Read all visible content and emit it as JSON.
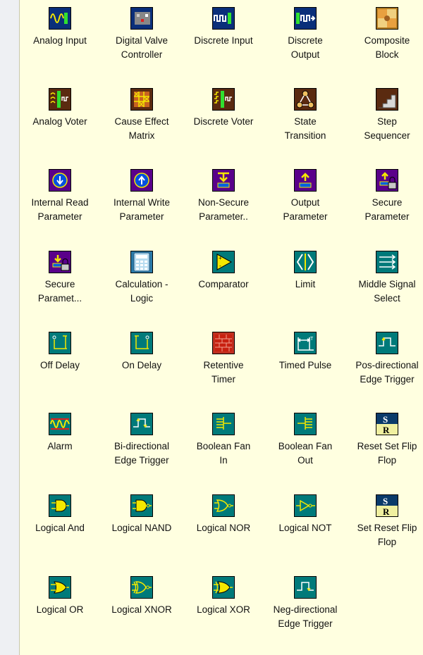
{
  "palette": {
    "items": [
      {
        "label_lines": [
          "Analog Input"
        ],
        "icon": "analog-input-icon",
        "color": "#0a2f7a"
      },
      {
        "label_lines": [
          "Digital Valve",
          "Controller"
        ],
        "icon": "digital-valve-controller-icon",
        "color": "#0a2f7a"
      },
      {
        "label_lines": [
          "Discrete Input"
        ],
        "icon": "discrete-input-icon",
        "color": "#0a2f7a"
      },
      {
        "label_lines": [
          "Discrete",
          "Output"
        ],
        "icon": "discrete-output-icon",
        "color": "#0a2f7a"
      },
      {
        "label_lines": [
          "Composite",
          "Block"
        ],
        "icon": "composite-block-icon",
        "color": "#b07a20"
      },
      {
        "label_lines": [
          "Analog Voter"
        ],
        "icon": "analog-voter-icon",
        "color": "#5a2a10"
      },
      {
        "label_lines": [
          "Cause Effect",
          "Matrix"
        ],
        "icon": "cause-effect-matrix-icon",
        "color": "#5a2a10"
      },
      {
        "label_lines": [
          "Discrete Voter"
        ],
        "icon": "discrete-voter-icon",
        "color": "#5a2a10"
      },
      {
        "label_lines": [
          "State",
          "Transition"
        ],
        "icon": "state-transition-icon",
        "color": "#5a2a10"
      },
      {
        "label_lines": [
          "Step",
          "Sequencer"
        ],
        "icon": "step-sequencer-icon",
        "color": "#5a2a10"
      },
      {
        "label_lines": [
          "Internal Read",
          "Parameter"
        ],
        "icon": "internal-read-parameter-icon",
        "color": "#5a008a"
      },
      {
        "label_lines": [
          "Internal Write",
          "Parameter"
        ],
        "icon": "internal-write-parameter-icon",
        "color": "#5a008a"
      },
      {
        "label_lines": [
          "Non-Secure",
          "Parameter.."
        ],
        "icon": "non-secure-parameter-icon",
        "color": "#5a008a"
      },
      {
        "label_lines": [
          "Output",
          "Parameter"
        ],
        "icon": "output-parameter-icon",
        "color": "#5a008a"
      },
      {
        "label_lines": [
          "Secure",
          "Parameter"
        ],
        "icon": "secure-parameter-icon",
        "color": "#5a008a"
      },
      {
        "label_lines": [
          "Secure",
          "Paramet..."
        ],
        "icon": "secure-parameter-input-icon",
        "color": "#5a008a"
      },
      {
        "label_lines": [
          "Calculation -",
          "Logic"
        ],
        "icon": "calculator-icon",
        "color": "#2a7aa8"
      },
      {
        "label_lines": [
          "Comparator"
        ],
        "icon": "comparator-icon",
        "color": "#007a7a"
      },
      {
        "label_lines": [
          "Limit"
        ],
        "icon": "limit-icon",
        "color": "#007a7a"
      },
      {
        "label_lines": [
          "Middle Signal",
          "Select"
        ],
        "icon": "middle-signal-select-icon",
        "color": "#007a7a"
      },
      {
        "label_lines": [
          "Off Delay"
        ],
        "icon": "off-delay-icon",
        "color": "#007a7a"
      },
      {
        "label_lines": [
          "On Delay"
        ],
        "icon": "on-delay-icon",
        "color": "#007a7a"
      },
      {
        "label_lines": [
          "Retentive",
          "Timer"
        ],
        "icon": "retentive-timer-icon",
        "color": "#c03020"
      },
      {
        "label_lines": [
          "Timed Pulse"
        ],
        "icon": "timed-pulse-icon",
        "color": "#007a7a"
      },
      {
        "label_lines": [
          "Pos-directional",
          "Edge Trigger"
        ],
        "icon": "pos-edge-trigger-icon",
        "color": "#007a7a"
      },
      {
        "label_lines": [
          "Alarm"
        ],
        "icon": "alarm-icon",
        "color": "#007a7a"
      },
      {
        "label_lines": [
          "Bi-directional",
          "Edge Trigger"
        ],
        "icon": "bi-edge-trigger-icon",
        "color": "#007a7a"
      },
      {
        "label_lines": [
          "Boolean Fan",
          "In"
        ],
        "icon": "boolean-fan-in-icon",
        "color": "#007a7a"
      },
      {
        "label_lines": [
          "Boolean Fan",
          "Out"
        ],
        "icon": "boolean-fan-out-icon",
        "color": "#007a7a"
      },
      {
        "label_lines": [
          "Reset Set Flip",
          "Flop"
        ],
        "icon": "reset-set-flip-flop-icon",
        "color": "#0a3a5a"
      },
      {
        "label_lines": [
          "Logical And"
        ],
        "icon": "logical-and-icon",
        "color": "#007a7a"
      },
      {
        "label_lines": [
          "Logical NAND"
        ],
        "icon": "logical-nand-icon",
        "color": "#007a7a"
      },
      {
        "label_lines": [
          "Logical NOR"
        ],
        "icon": "logical-nor-icon",
        "color": "#007a7a"
      },
      {
        "label_lines": [
          "Logical NOT"
        ],
        "icon": "logical-not-icon",
        "color": "#007a7a"
      },
      {
        "label_lines": [
          "Set Reset Flip",
          "Flop"
        ],
        "icon": "set-reset-flip-flop-icon",
        "color": "#0a3a5a"
      },
      {
        "label_lines": [
          "Logical OR"
        ],
        "icon": "logical-or-icon",
        "color": "#007a7a"
      },
      {
        "label_lines": [
          "Logical XNOR"
        ],
        "icon": "logical-xnor-icon",
        "color": "#007a7a"
      },
      {
        "label_lines": [
          "Logical XOR"
        ],
        "icon": "logical-xor-icon",
        "color": "#007a7a"
      },
      {
        "label_lines": [
          "Neg-directional",
          "Edge Trigger"
        ],
        "icon": "neg-edge-trigger-icon",
        "color": "#007a7a"
      }
    ]
  }
}
